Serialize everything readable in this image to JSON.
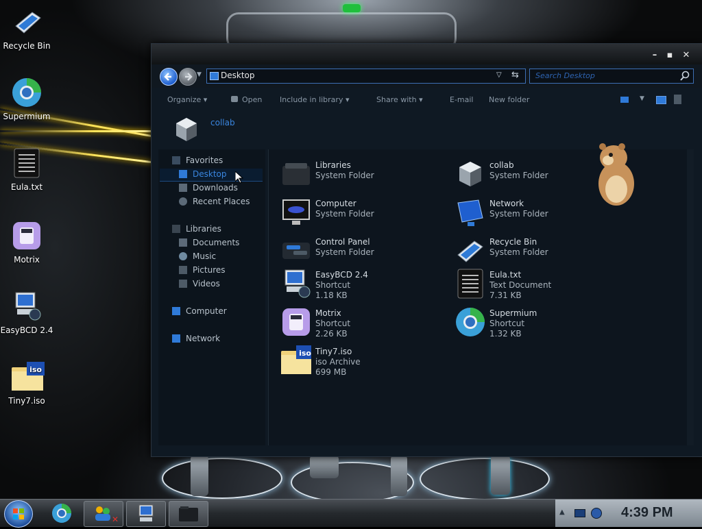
{
  "desktop": {
    "icons": [
      {
        "label": "Recycle Bin"
      },
      {
        "label": "Supermium"
      },
      {
        "label": "Eula.txt"
      },
      {
        "label": "Motrix"
      },
      {
        "label": "EasyBCD 2.4"
      },
      {
        "label": "Tiny7.iso"
      }
    ]
  },
  "explorer": {
    "address": "Desktop",
    "search_placeholder": "Search Desktop",
    "toolbar": {
      "organize": "Organize",
      "open": "Open",
      "include_in_library": "Include in library",
      "share_with": "Share with",
      "email": "E-mail",
      "new_folder": "New folder"
    },
    "user_folder": "collab",
    "nav": {
      "favorites": "Favorites",
      "desktop": "Desktop",
      "downloads": "Downloads",
      "recent_places": "Recent Places",
      "libraries": "Libraries",
      "documents": "Documents",
      "music": "Music",
      "pictures": "Pictures",
      "videos": "Videos",
      "computer": "Computer",
      "network": "Network"
    },
    "items": [
      {
        "name": "Libraries",
        "type": "System Folder",
        "size": ""
      },
      {
        "name": "collab",
        "type": "System Folder",
        "size": ""
      },
      {
        "name": "Computer",
        "type": "System Folder",
        "size": ""
      },
      {
        "name": "Network",
        "type": "System Folder",
        "size": ""
      },
      {
        "name": "Control Panel",
        "type": "System Folder",
        "size": ""
      },
      {
        "name": "Recycle Bin",
        "type": "System Folder",
        "size": ""
      },
      {
        "name": "EasyBCD 2.4",
        "type": "Shortcut",
        "size": "1.18 KB"
      },
      {
        "name": "Eula.txt",
        "type": "Text Document",
        "size": "7.31 KB"
      },
      {
        "name": "Motrix",
        "type": "Shortcut",
        "size": "2.26 KB"
      },
      {
        "name": "Supermium",
        "type": "Shortcut",
        "size": "1.32 KB"
      },
      {
        "name": "Tiny7.iso",
        "type": "iso Archive",
        "size": "699 MB"
      }
    ]
  },
  "taskbar": {
    "clock": "4:39 PM"
  },
  "colors": {
    "accent": "#3d6fb5",
    "window_bg": "#0f1923",
    "selection": "#2a6fd1"
  }
}
